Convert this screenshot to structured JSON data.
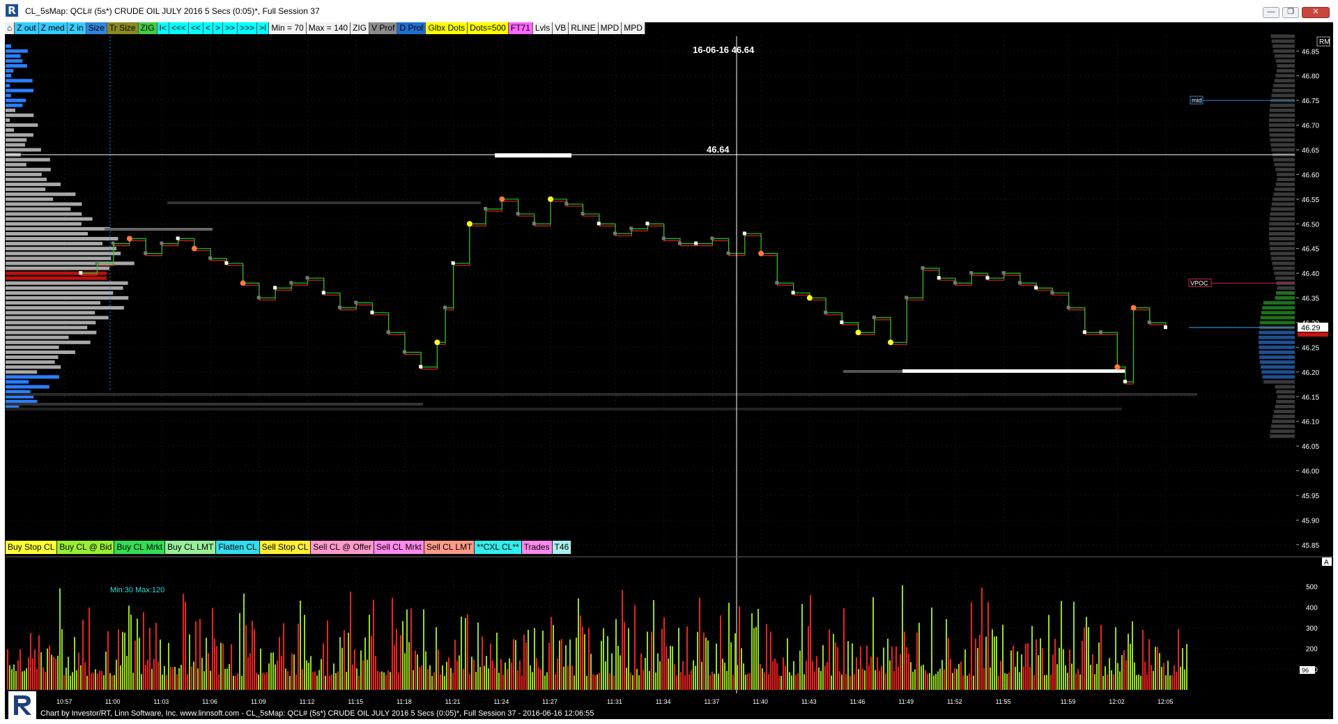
{
  "window": {
    "title": "CL_5sMap: QCL# (5s*) CRUDE OIL JULY 2016 5 Secs (0:05)*, Full Session 37",
    "app_icon": "R",
    "controls": {
      "minimize": "minimize-icon",
      "restore": "restore-icon",
      "close": "close-icon"
    }
  },
  "toolbar": {
    "items": [
      {
        "label": "⌂",
        "bg": "#f0f0f0"
      },
      {
        "label": "Z out",
        "bg": "#33ccff"
      },
      {
        "label": "Z med",
        "bg": "#33ccff"
      },
      {
        "label": "Z in",
        "bg": "#33ccff"
      },
      {
        "label": "Size",
        "bg": "#2f86e0"
      },
      {
        "label": "Tr Size",
        "bg": "#8a8a20"
      },
      {
        "label": "ZIG",
        "bg": "#44cc44"
      },
      {
        "label": "I<",
        "bg": "#00ffff"
      },
      {
        "label": "<<<",
        "bg": "#00ffff"
      },
      {
        "label": "<<",
        "bg": "#00ffff"
      },
      {
        "label": "<",
        "bg": "#00ffff"
      },
      {
        "label": ">",
        "bg": "#00ffff"
      },
      {
        "label": ">>",
        "bg": "#00ffff"
      },
      {
        "label": ">>>",
        "bg": "#00ffff"
      },
      {
        "label": ">I",
        "bg": "#00ffff"
      },
      {
        "label": "Min = 70",
        "bg": "#f2f2f2"
      },
      {
        "label": "Max = 140",
        "bg": "#f2f2f2"
      },
      {
        "label": "ZIG",
        "bg": "#f2f2f2"
      },
      {
        "label": "V Prof",
        "bg": "#8c8c8c"
      },
      {
        "label": "D Prof",
        "bg": "#1f6fd1"
      },
      {
        "label": "Glbx Dots",
        "bg": "#ffff00"
      },
      {
        "label": "Dots=500",
        "bg": "#ffff00"
      },
      {
        "label": "FT71",
        "bg": "#ff66ff"
      },
      {
        "label": "Lvls",
        "bg": "#f2f2f2"
      },
      {
        "label": "VB",
        "bg": "#f2f2f2"
      },
      {
        "label": "RLINE",
        "bg": "#f2f2f2"
      },
      {
        "label": "MPD",
        "bg": "#f2f2f2"
      },
      {
        "label": "MPD",
        "bg": "#f2f2f2"
      }
    ]
  },
  "orders": {
    "items": [
      {
        "label": "Buy Stop CL",
        "bg": "#ffff33"
      },
      {
        "label": "Buy CL @ Bid",
        "bg": "#99ee33"
      },
      {
        "label": "Buy CL Mrkt",
        "bg": "#33dd55"
      },
      {
        "label": "Buy CL LMT",
        "bg": "#99ee99"
      },
      {
        "label": "Flatten CL",
        "bg": "#33ddee"
      },
      {
        "label": "Sell Stop CL",
        "bg": "#ffee33"
      },
      {
        "label": "Sell CL @ Offer",
        "bg": "#ff99cc"
      },
      {
        "label": "Sell CL Mrkt",
        "bg": "#ff88ee"
      },
      {
        "label": "Sell CL LMT",
        "bg": "#ff9988"
      },
      {
        "label": "**CXL CL**",
        "bg": "#33eeee"
      },
      {
        "label": "Trades",
        "bg": "#ff88ee"
      },
      {
        "label": "T46",
        "bg": "#aaeeee"
      }
    ]
  },
  "cursor": {
    "date_price": "16-06-16 46.64",
    "price_label": "46.64"
  },
  "labels": {
    "rm": "RM",
    "mid": "mid",
    "vpoc": "VPOC",
    "last_price": "46.29",
    "volume_minmax": "Min:30 Max:120",
    "volume_last": "96",
    "volume_pane_tag": "A"
  },
  "footer": "Chart by Investor/RT, Linn Software, Inc. www.linnsoft.com - CL_5sMap: QCL# (5s*) CRUDE OIL JULY 2016 5 Secs (0:05)*, Full Session 37 - 2016-06-16 12:06:55",
  "colors": {
    "background": "#000000",
    "price_up": "#22cc22",
    "price_down": "#dd2222",
    "volume_up": "#99dd22",
    "volume_down": "#ee2222",
    "profile_grey": "#a8a8a8",
    "profile_blue": "#2a7fff",
    "vpoc_bar": "#bb1111",
    "mid_line": "#2f86e0",
    "vpoc_line": "#cc2266",
    "axis_text": "#ffffff"
  },
  "chart_data": {
    "type": "line",
    "x_ticks": [
      "10:57",
      "11:00",
      "11:03",
      "11:06",
      "11:09",
      "11:12",
      "11:15",
      "11:18",
      "11:21",
      "11:24",
      "11:27",
      "11:31",
      "11:34",
      "11:37",
      "11:40",
      "11:43",
      "11:46",
      "11:49",
      "11:52",
      "11:55",
      "11:59",
      "12:02",
      "12:05"
    ],
    "y_ticks": [
      "46.85",
      "46.80",
      "46.75",
      "46.70",
      "46.65",
      "46.60",
      "46.55",
      "46.50",
      "46.45",
      "46.40",
      "46.35",
      "46.30",
      "46.25",
      "46.20",
      "46.15",
      "46.10",
      "46.05",
      "46.00",
      "45.95",
      "45.90",
      "45.85"
    ],
    "ylim": [
      45.83,
      46.88
    ],
    "price": {
      "x": [
        "10:58",
        "10:59",
        "11:00",
        "11:01",
        "11:02",
        "11:03",
        "11:04",
        "11:05",
        "11:06",
        "11:07",
        "11:08",
        "11:09",
        "11:10",
        "11:11",
        "11:12",
        "11:13",
        "11:14",
        "11:15",
        "11:16",
        "11:17",
        "11:18",
        "11:19",
        "11:20",
        "11:20:30",
        "11:21",
        "11:22",
        "11:23",
        "11:24",
        "11:25",
        "11:26",
        "11:27",
        "11:28",
        "11:29",
        "11:30",
        "11:31",
        "11:32",
        "11:33",
        "11:34",
        "11:35",
        "11:36",
        "11:37",
        "11:38",
        "11:39",
        "11:40",
        "11:41",
        "11:42",
        "11:43",
        "11:44",
        "11:45",
        "11:46",
        "11:47",
        "11:48",
        "11:49",
        "11:50",
        "11:51",
        "11:52",
        "11:53",
        "11:54",
        "11:55",
        "11:56",
        "11:57",
        "11:58",
        "11:59",
        "12:00",
        "12:01",
        "12:02",
        "12:02:30",
        "12:03",
        "12:04",
        "12:05"
      ],
      "values": [
        46.4,
        46.42,
        46.46,
        46.47,
        46.44,
        46.46,
        46.47,
        46.45,
        46.43,
        46.42,
        46.38,
        46.35,
        46.37,
        46.38,
        46.39,
        46.36,
        46.33,
        46.34,
        46.32,
        46.28,
        46.24,
        46.21,
        46.26,
        46.33,
        46.42,
        46.5,
        46.53,
        46.55,
        46.52,
        46.5,
        46.55,
        46.54,
        46.52,
        46.5,
        46.48,
        46.49,
        46.5,
        46.47,
        46.46,
        46.46,
        46.47,
        46.44,
        46.48,
        46.44,
        46.38,
        46.36,
        46.35,
        46.32,
        46.3,
        46.28,
        46.31,
        46.26,
        46.35,
        46.41,
        46.39,
        46.38,
        46.4,
        46.39,
        46.4,
        46.38,
        46.37,
        46.36,
        46.33,
        46.28,
        46.28,
        46.21,
        46.18,
        46.33,
        46.3,
        46.29
      ]
    },
    "volume": {
      "y_ticks": [
        "500",
        "400",
        "300",
        "200",
        "100"
      ],
      "ylim": [
        0,
        600
      ],
      "min": 30,
      "max": 120,
      "last": 96
    },
    "levels": {
      "cursor_price": 46.64,
      "mid": 46.75,
      "vpoc": 46.38,
      "last": 46.29,
      "vpoc_left": 46.395
    }
  }
}
